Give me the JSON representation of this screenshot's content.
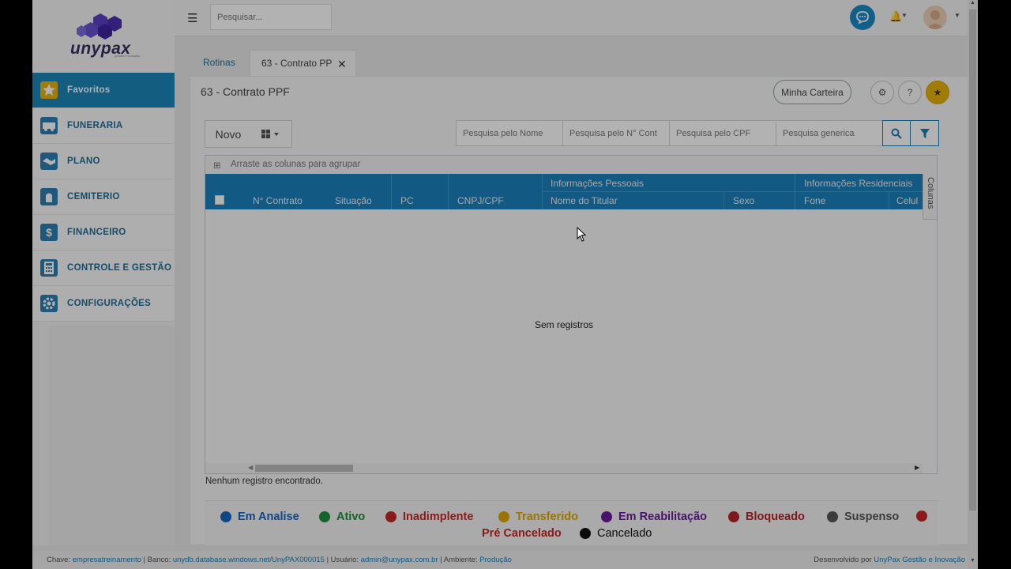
{
  "brand": {
    "name": "unypax",
    "tagline": "gestão e inovação"
  },
  "sidebar": {
    "items": [
      {
        "label": "Favoritos",
        "icon": "star-icon",
        "active": true
      },
      {
        "label": "FUNERARIA",
        "icon": "hearse-icon"
      },
      {
        "label": "PLANO",
        "icon": "handshake-icon"
      },
      {
        "label": "CEMITERIO",
        "icon": "cemetery-icon"
      },
      {
        "label": "FINANCEIRO",
        "icon": "dollar-icon"
      },
      {
        "label": "CONTROLE E GESTÃO",
        "icon": "calculator-icon"
      },
      {
        "label": "CONFIGURAÇÕES",
        "icon": "gear-icon"
      }
    ]
  },
  "topbar": {
    "search_placeholder": "Pesquisar..."
  },
  "tabs": [
    {
      "label": "Rotinas"
    },
    {
      "label": "63 - Contrato PP",
      "closable": true
    }
  ],
  "page": {
    "title": "63 - Contrato PPF",
    "minha_carteira": "Minha Carteira",
    "new_button": "Novo"
  },
  "filters": {
    "nome": "Pesquisa pelo Nome",
    "contrato": "Pesquisa pelo N° Cont",
    "cpf": "Pesquisa pelo CPF",
    "generica": "Pesquisa generica"
  },
  "grid": {
    "group_hint": "Arraste as colunas para agrupar",
    "group_headers": [
      "Informações Pessoais",
      "Informações Residenciais"
    ],
    "columns": [
      "N° Contrato",
      "Situação",
      "PC",
      "CNPJ/CPF",
      "Nome do Titular",
      "Sexo",
      "Fone",
      "Celul"
    ],
    "side_tab": "Colunas",
    "empty_text": "Sem registros",
    "status_text": "Nenhum registro encontrado."
  },
  "legend": [
    {
      "label": "Em Analise",
      "color": "#1565c0"
    },
    {
      "label": "Ativo",
      "color": "#1e8e3e"
    },
    {
      "label": "Inadimplente",
      "color": "#c62828"
    },
    {
      "label": "Transferido",
      "color": "#e0a800"
    },
    {
      "label": "Em Reabilitação",
      "color": "#6a1b9a"
    },
    {
      "label": "Bloqueado",
      "color": "#b32424"
    },
    {
      "label": "Suspenso",
      "color": "#555555"
    },
    {
      "label": "Pré Cancelado",
      "color": "#c62828"
    },
    {
      "label": "Cancelado",
      "color": "#111111"
    }
  ],
  "footer": {
    "chave_label": "Chave:",
    "chave": "empresatreinamento",
    "banco_label": "| Banco:",
    "banco": "unydb.database.windows.net/UnyPAX000015",
    "usuario_label": "| Usuário:",
    "usuario": "admin@unypax.com.br",
    "ambiente_label": "| Ambiente:",
    "ambiente": "Produção",
    "dev_label": "Desenvolvido por",
    "dev": "UnyPax Gestão e Inovação"
  },
  "colors": {
    "accent": "#1b82bd",
    "star": "#e8b20c"
  }
}
